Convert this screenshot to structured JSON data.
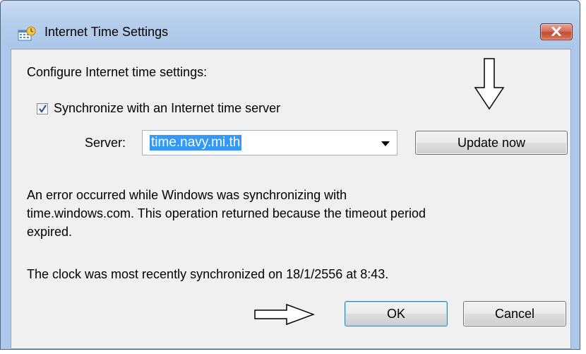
{
  "window": {
    "title": "Internet Time Settings",
    "close_icon": "close-icon"
  },
  "dialog": {
    "heading": "Configure Internet time settings:",
    "sync_checkbox": {
      "label": "Synchronize with an Internet time server",
      "checked": true
    },
    "server": {
      "label": "Server:",
      "value": "time.navy.mi.th"
    },
    "update_button": "Update now",
    "error_lines": [
      "An error occurred while Windows was synchronizing with",
      "time.windows.com.  This operation returned because the timeout period",
      "expired."
    ],
    "last_sync": "The clock was most recently synchronized on 18/1/2556 at 8:43.",
    "ok_button": "OK",
    "cancel_button": "Cancel"
  },
  "annotations": {
    "down_arrow_icon": "down-arrow-annotation-icon",
    "right_arrow_icon": "right-arrow-annotation-icon"
  },
  "colors": {
    "selection": "#3399ff",
    "frame": "#aec8e9",
    "client": "#f0f0f0"
  }
}
